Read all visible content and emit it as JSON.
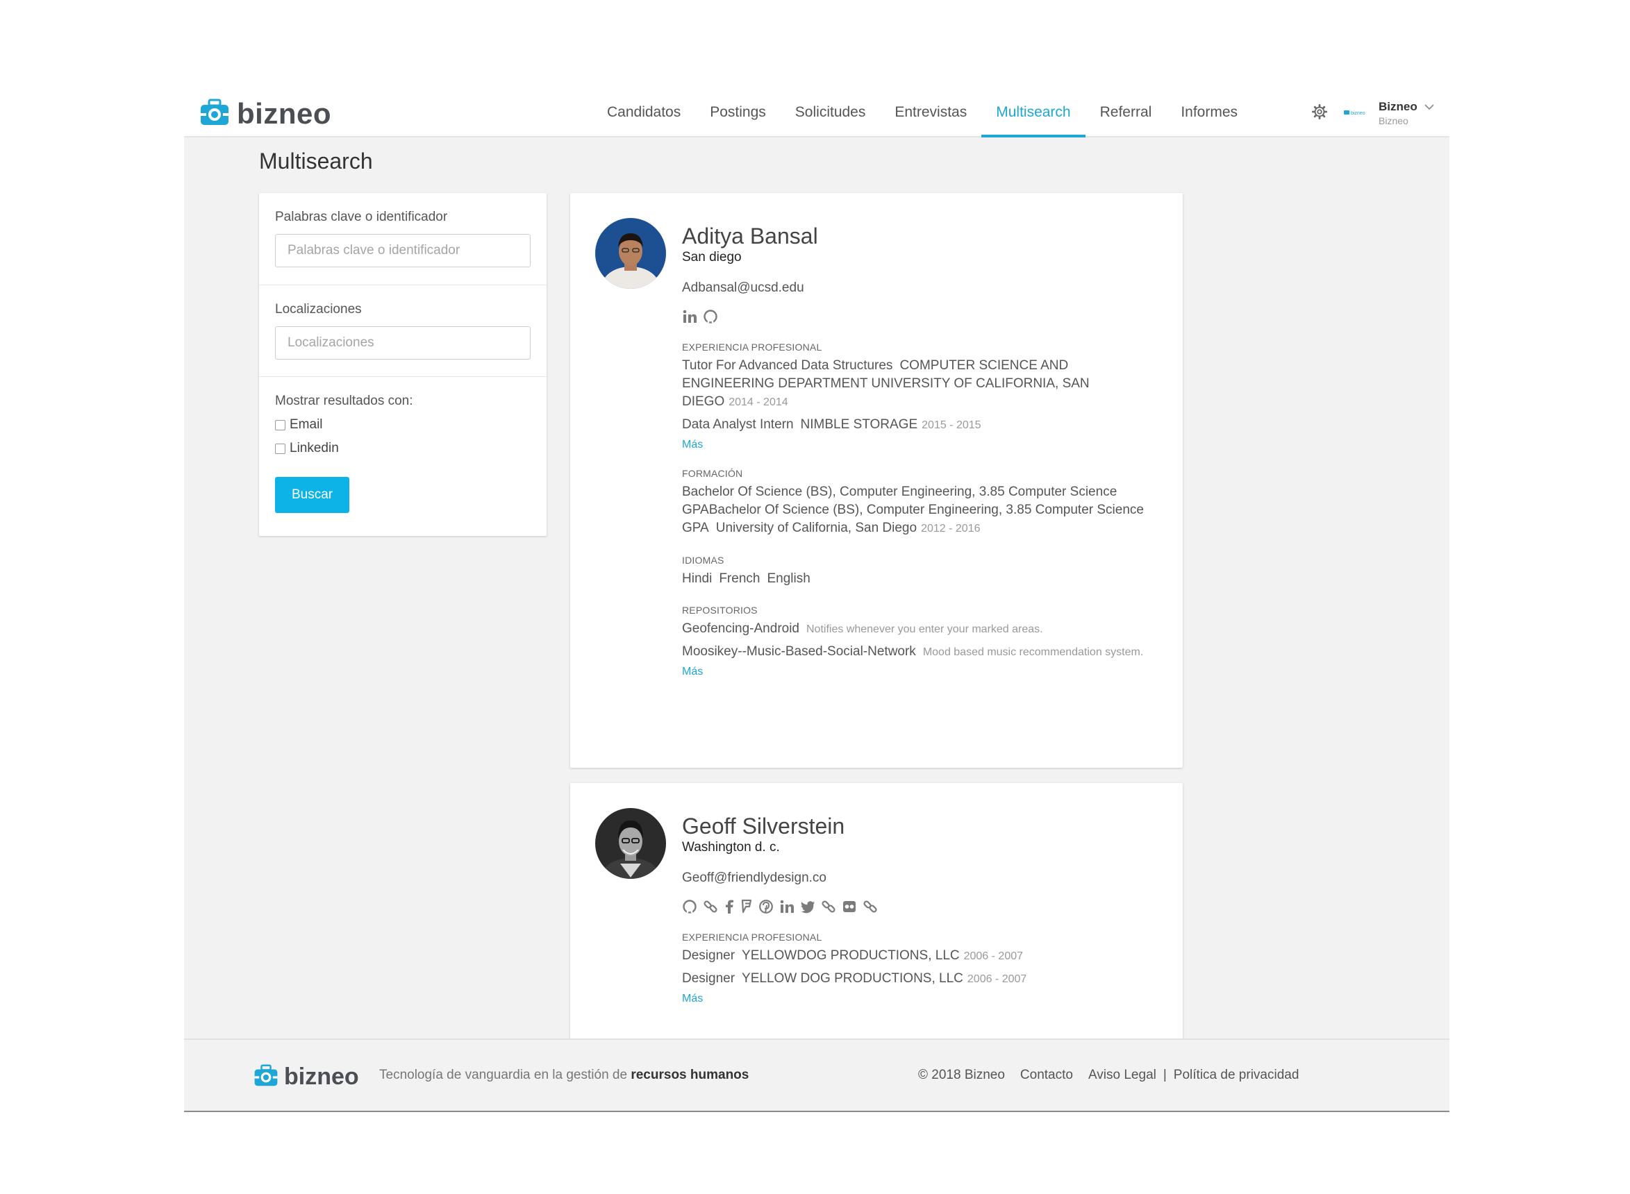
{
  "brand": {
    "name": "bizneo",
    "accent": "#1ea7d6",
    "button": "#0db3e6"
  },
  "nav": {
    "items": [
      {
        "label": "Candidatos"
      },
      {
        "label": "Postings"
      },
      {
        "label": "Solicitudes"
      },
      {
        "label": "Entrevistas"
      },
      {
        "label": "Multisearch",
        "active": true
      },
      {
        "label": "Referral"
      },
      {
        "label": "Informes"
      }
    ],
    "settings_icon": "gear-icon",
    "mini_logo": "bizneo"
  },
  "user": {
    "name": "Bizneo",
    "company": "Bizneo"
  },
  "page": {
    "title": "Multisearch"
  },
  "filters": {
    "keywords_label": "Palabras clave o identificador",
    "keywords_placeholder": "Palabras clave o identificador",
    "keywords_value": "",
    "locations_label": "Localizaciones",
    "locations_placeholder": "Localizaciones",
    "locations_value": "",
    "show_label": "Mostrar resultados con:",
    "options": [
      {
        "label": "Email",
        "checked": false
      },
      {
        "label": "Linkedin",
        "checked": false
      }
    ],
    "search_button": "Buscar"
  },
  "candidates": [
    {
      "name": "Aditya Bansal",
      "location": "San diego",
      "email": "Adbansal@ucsd.edu",
      "icons": [
        "linkedin-icon",
        "github-icon"
      ],
      "experience_header": "EXPERIENCIA PROFESIONAL",
      "experience": [
        {
          "title": "Tutor For Advanced Data Structures",
          "company": "COMPUTER SCIENCE AND ENGINEERING DEPARTMENT UNIVERSITY OF CALIFORNIA, SAN DIEGO",
          "years": "2014 - 2014"
        },
        {
          "title": "Data Analyst Intern",
          "company": "NIMBLE STORAGE",
          "years": "2015 - 2015"
        }
      ],
      "experience_more": "Más",
      "education_header": "FORMACIÓN",
      "education": [
        {
          "degree": "Bachelor Of Science (BS), Computer Engineering, 3.85 Computer Science GPABachelor Of Science (BS), Computer Engineering, 3.85 Computer Science GPA",
          "school": "University of California, San Diego",
          "years": "2012 - 2016"
        }
      ],
      "languages_header": "IDIOMAS",
      "languages": [
        "Hindi",
        "French",
        "English"
      ],
      "repos_header": "REPOSITORIOS",
      "repos": [
        {
          "name": "Geofencing-Android",
          "description": "Notifies whenever you enter your marked areas."
        },
        {
          "name": "Moosikey--Music-Based-Social-Network",
          "description": "Mood based music recommendation system."
        }
      ],
      "repos_more": "Más"
    },
    {
      "name": "Geoff Silverstein",
      "location": "Washington d. c.",
      "email": "Geoff@friendlydesign.co",
      "icons": [
        "github-icon",
        "link-icon",
        "facebook-icon",
        "foursquare-icon",
        "pinterest-icon",
        "linkedin-icon",
        "twitter-icon",
        "link-icon",
        "flickr-icon",
        "link-icon"
      ],
      "experience_header": "EXPERIENCIA PROFESIONAL",
      "experience": [
        {
          "title": "Designer",
          "company": "YELLOWDOG PRODUCTIONS, LLC",
          "years": "2006 - 2007"
        },
        {
          "title": "Designer",
          "company": "YELLOW DOG PRODUCTIONS, LLC",
          "years": "2006 - 2007"
        }
      ],
      "experience_more": "Más"
    }
  ],
  "footer": {
    "brand": "bizneo",
    "tagline_prefix": "Tecnología de vanguardia en la gestión de",
    "tagline_bold": "recursos humanos",
    "copyright": "© 2018 Bizneo",
    "contact": "Contacto",
    "legal": "Aviso Legal",
    "separator": "|",
    "privacy": "Política de privacidad"
  }
}
